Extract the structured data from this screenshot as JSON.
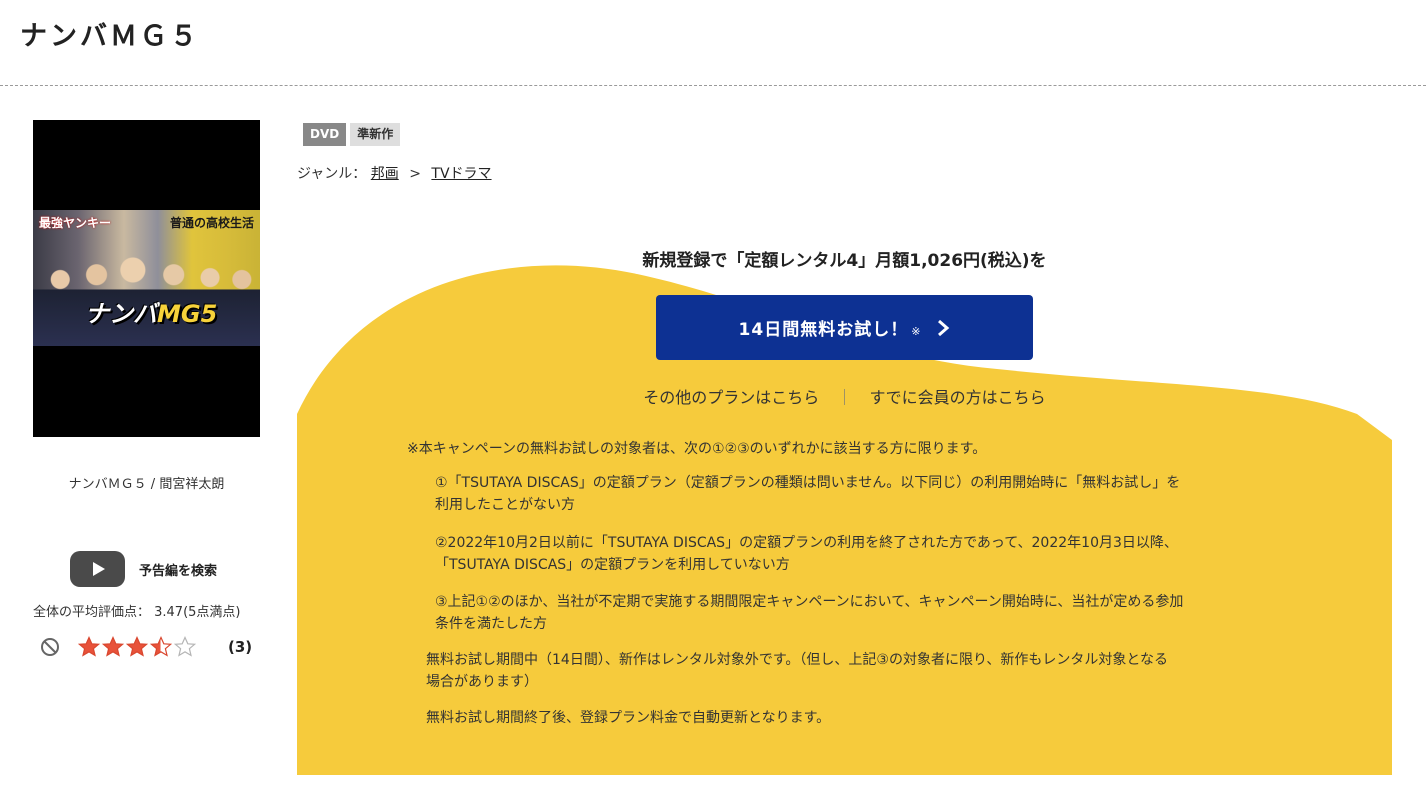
{
  "page": {
    "title": "ナンバＭＧ５"
  },
  "work": {
    "poster_text": {
      "top_left": "最強ヤンキー",
      "top_right": "普通の高校生活",
      "logo_main": "ナンバ",
      "logo_sub": "MG5"
    },
    "caption": "ナンバＭＧ５ / 間宮祥太朗"
  },
  "trailer": {
    "label": "予告編を検索"
  },
  "rating": {
    "average_text": "全体の平均評価点： 3.47(5点満点)",
    "average": 3.47,
    "max": 5,
    "review_count": "(3)"
  },
  "badges": [
    "DVD",
    "準新作"
  ],
  "genre": {
    "label": "ジャンル：",
    "links": [
      "邦画",
      "TVドラマ"
    ],
    "separator": ">"
  },
  "promo": {
    "heading": "新規登録で「定額レンタル4」月額1,026円(税込)を",
    "cta_label": "14日間無料お試し！",
    "cta_note": "※",
    "other_plans": "その他のプランはこちら",
    "divider": "｜",
    "members": "すでに会員の方はこちら",
    "bg_color": "#f6cb3c",
    "cta_color": "#0d3193"
  },
  "terms": {
    "lead": "※本キャンペーンの無料お試しの対象者は、次の①②③のいずれかに該当する方に限ります。",
    "items": [
      {
        "line1": "①「TSUTAYA DISCAS」の定額プラン（定額プランの種類は問いません。以下同じ）の利用開始時に「無料お試し」を",
        "line2": "利用したことがない方"
      },
      {
        "line1": "②2022年10月2日以前に「TSUTAYA DISCAS」の定額プランの利用を終了された方であって、2022年10月3日以降、",
        "line2": "「TSUTAYA DISCAS」の定額プランを利用していない方"
      },
      {
        "line1": "③上記①②のほか、当社が不定期で実施する期間限定キャンペーンにおいて、キャンペーン開始時に、当社が定める参加",
        "line2": "条件を満たした方"
      }
    ],
    "notes": [
      {
        "line1": "無料お試し期間中（14日間）、新作はレンタル対象外です。（但し、上記③の対象者に限り、新作もレンタル対象となる",
        "line2": "場合があります）"
      },
      {
        "line1": "無料お試し期間終了後、登録プラン料金で自動更新となります。",
        "line2": ""
      }
    ]
  }
}
